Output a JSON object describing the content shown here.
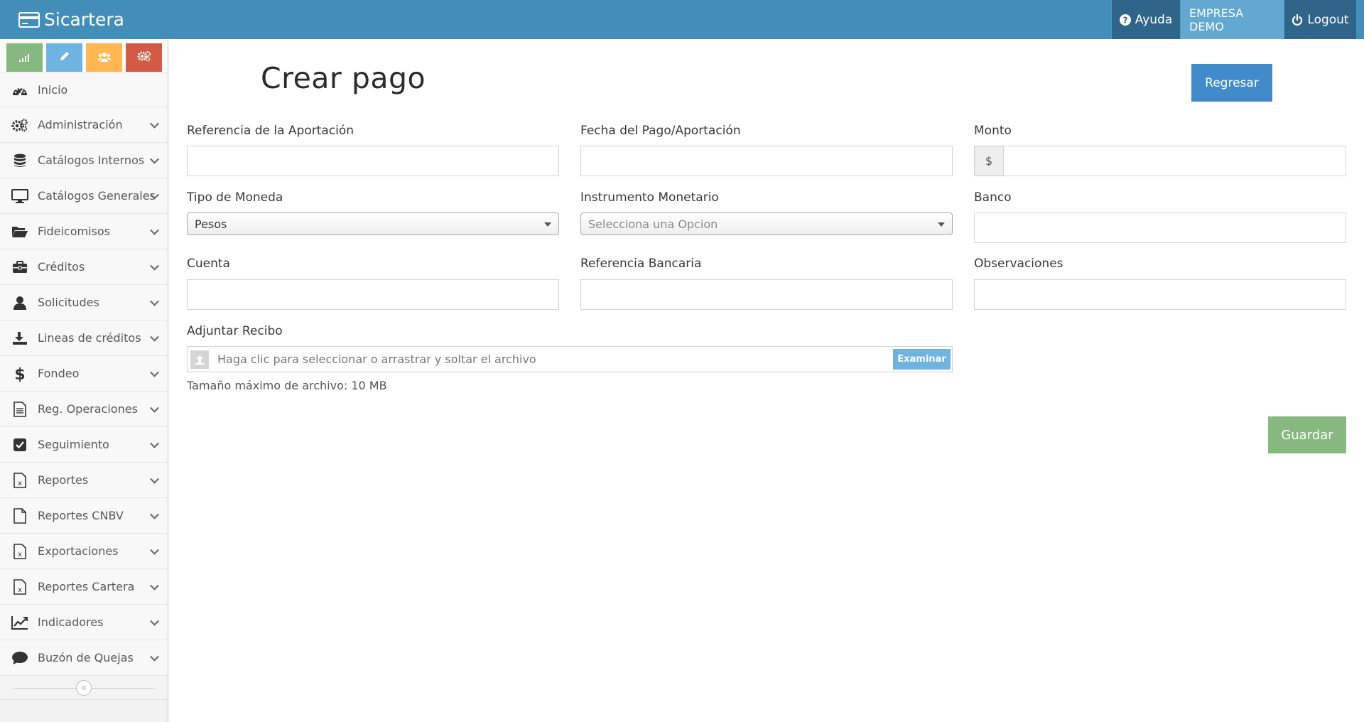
{
  "navbar": {
    "brand": "Sicartera",
    "help_label": "Ayuda",
    "company_label": "EMPRESA DEMO",
    "logout_label": "Logout"
  },
  "sidebar": {
    "shortcuts": [
      {
        "name": "stats-shortcut",
        "icon": "signal-icon",
        "color": "#87b87f"
      },
      {
        "name": "edit-shortcut",
        "icon": "pencil-icon",
        "color": "#6fb3e0"
      },
      {
        "name": "users-shortcut",
        "icon": "group-icon",
        "color": "#ffb752"
      },
      {
        "name": "settings-shortcut",
        "icon": "cogs-icon",
        "color": "#d15b47"
      }
    ],
    "items": [
      {
        "label": "Inicio",
        "icon": "dashboard-icon"
      },
      {
        "label": "Administración",
        "icon": "cogs-icon"
      },
      {
        "label": "Catálogos Internos",
        "icon": "database-icon"
      },
      {
        "label": "Catálogos Generales",
        "icon": "desktop-icon"
      },
      {
        "label": "Fideicomisos",
        "icon": "folder-open-icon"
      },
      {
        "label": "Créditos",
        "icon": "briefcase-icon"
      },
      {
        "label": "Solicitudes",
        "icon": "user-icon"
      },
      {
        "label": "Lineas de créditos",
        "icon": "download-icon"
      },
      {
        "label": "Fondeo",
        "icon": "dollar-icon"
      },
      {
        "label": "Reg. Operaciones",
        "icon": "file-text-icon"
      },
      {
        "label": "Seguimiento",
        "icon": "check-square-icon"
      },
      {
        "label": "Reportes",
        "icon": "file-excel-icon"
      },
      {
        "label": "Reportes CNBV",
        "icon": "file-icon"
      },
      {
        "label": "Exportaciones",
        "icon": "file-excel-icon"
      },
      {
        "label": "Reportes Cartera",
        "icon": "file-excel-icon"
      },
      {
        "label": "Indicadores",
        "icon": "line-chart-icon"
      },
      {
        "label": "Buzón de Quejas",
        "icon": "comment-icon"
      }
    ],
    "collapse_icon": "double-angle-left-icon"
  },
  "main": {
    "title": "Crear pago",
    "back_button": "Regresar",
    "save_button": "Guardar",
    "fields": {
      "referencia_aportacion": {
        "label": "Referencia de la Aportación",
        "value": ""
      },
      "fecha_pago": {
        "label": "Fecha del Pago/Aportación",
        "value": ""
      },
      "monto": {
        "label": "Monto",
        "addon": "$",
        "value": ""
      },
      "tipo_moneda": {
        "label": "Tipo de Moneda",
        "selected": "Pesos"
      },
      "instrumento_monetario": {
        "label": "Instrumento Monetario",
        "selected": "Selecciona una Opcion"
      },
      "banco": {
        "label": "Banco",
        "value": ""
      },
      "cuenta": {
        "label": "Cuenta",
        "value": ""
      },
      "referencia_bancaria": {
        "label": "Referencia Bancaria",
        "value": ""
      },
      "observaciones": {
        "label": "Observaciones",
        "value": ""
      }
    },
    "attachment": {
      "label": "Adjuntar Recibo",
      "placeholder": "Haga clic para seleccionar o arrastrar y soltar el archivo",
      "browse_button": "Examinar",
      "help": "Tamaño máximo de archivo: 10 MB"
    }
  },
  "colors": {
    "navbar": "#438eb9",
    "help_bg": "#2e6589",
    "company_bg": "#62a8d1",
    "primary_button": "#428bca",
    "success_button": "#87b87f",
    "sidebar_bg": "#f2f2f2"
  }
}
